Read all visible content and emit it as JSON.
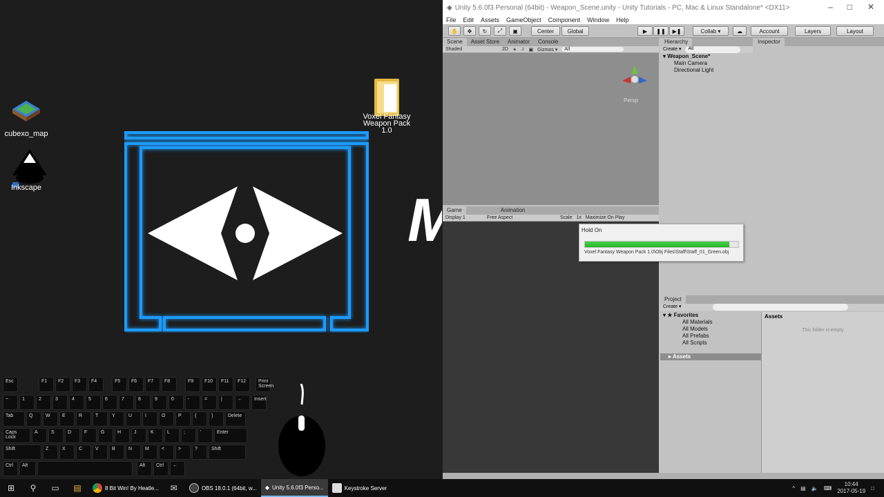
{
  "desktop": {
    "icons": [
      {
        "label": "cubexo_map"
      },
      {
        "label": "Inkscape"
      },
      {
        "label": "Voxel Fantasy Weapon Pack 1.0"
      }
    ],
    "overlay_letter": "M"
  },
  "keyboard": {
    "row1": [
      "Esc",
      "F1",
      "F2",
      "F3",
      "F4",
      "F5",
      "F6",
      "F7",
      "F8",
      "F9",
      "F10",
      "F11",
      "F12",
      "Print Screen"
    ],
    "row2": [
      "~",
      "1",
      "2",
      "3",
      "4",
      "5",
      "6",
      "7",
      "8",
      "9",
      "0",
      "-",
      "=",
      "|",
      "←",
      "Insert"
    ],
    "row3": [
      "Tab",
      "Q",
      "W",
      "E",
      "R",
      "T",
      "Y",
      "U",
      "I",
      "O",
      "P",
      "{",
      "}",
      "Delete"
    ],
    "row4": [
      "Caps Lock",
      "A",
      "S",
      "D",
      "F",
      "G",
      "H",
      "J",
      "K",
      "L",
      ";",
      "'",
      "Enter"
    ],
    "row5": [
      "Shift",
      "Z",
      "X",
      "C",
      "V",
      "B",
      "N",
      "M",
      "<",
      ">",
      "?",
      "Shift"
    ],
    "row6": [
      "Ctrl",
      "Alt",
      "Alt",
      "Ctrl",
      "←"
    ]
  },
  "unity": {
    "title": "Unity 5.6.0f3 Personal (64bit) - Weapon_Scene.unity - Unity Tutorials - PC, Mac & Linux Standalone* <DX11>",
    "menu": [
      "File",
      "Edit",
      "Assets",
      "GameObject",
      "Component",
      "Window",
      "Help"
    ],
    "toolbar": {
      "center": "Center",
      "global": "Global",
      "collab": "Collab ▾",
      "account": "Account",
      "layers": "Layers",
      "layout": "Layout"
    },
    "scene_tabs": [
      "Scene",
      "Asset Store",
      "Animator",
      "Console"
    ],
    "scene_bar": {
      "shaded": "Shaded",
      "two_d": "2D",
      "gizmos": "Gizmos ▾",
      "search": "All"
    },
    "persp": "Persp",
    "game_tabs": [
      "Game",
      "Animation"
    ],
    "game_bar": {
      "display": "Display 1",
      "aspect": "Free Aspect",
      "scale": "Scale",
      "scale_val": "1x",
      "maximize": "Maximize On Play"
    },
    "hierarchy": {
      "tab": "Hierarchy",
      "create": "Create ▾",
      "search": "All",
      "scene": "Weapon_Scene*",
      "items": [
        "Main Camera",
        "Directional Light"
      ]
    },
    "inspector": {
      "tab": "Inspector"
    },
    "project": {
      "tab": "Project",
      "create": "Create ▾",
      "favorites_title": "Favorites",
      "favorites": [
        "All Materials",
        "All Models",
        "All Prefabs",
        "All Scripts"
      ],
      "assets_folder": "Assets",
      "content_title": "Assets",
      "empty_msg": "This folder is empty"
    },
    "hold_on": {
      "title": "Hold On",
      "progress": 0.94,
      "path": "Voxel Fantasy Weapon Pack 1.0\\Obj Files\\Staff\\Staff_01_Green.obj"
    }
  },
  "taskbar": {
    "apps": [
      {
        "label": "8 Bit Win! By Heatle..."
      },
      {
        "label": "OBS 18.0.1 (64bit, w..."
      },
      {
        "label": "Unity 5.6.0f3 Perso..."
      },
      {
        "label": "Keystroke Server"
      }
    ],
    "time": "10:44",
    "date": "2017-05-19"
  },
  "colors": {
    "neon_blue": "#1a9bff",
    "unity_gray": "#c2c2c2",
    "progress_green": "#28b828"
  }
}
